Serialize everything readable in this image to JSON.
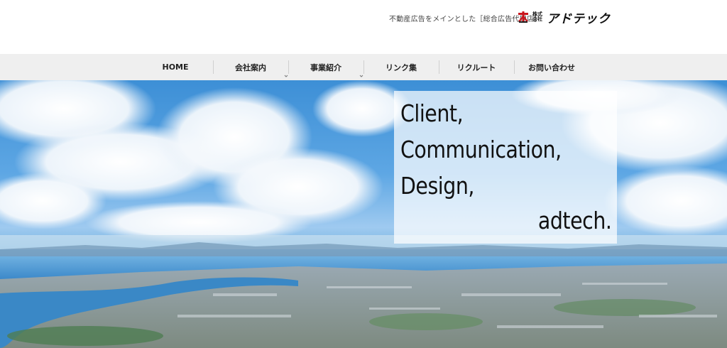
{
  "header": {
    "tagline": "不動産広告をメインとした［総合広告代理店］",
    "logo": {
      "small_top": "株式",
      "small_bottom": "会社",
      "name": "アドテック"
    }
  },
  "nav": {
    "items": [
      {
        "label": "HOME",
        "has_submenu": false
      },
      {
        "label": "会社案内",
        "has_submenu": true
      },
      {
        "label": "事業紹介",
        "has_submenu": true
      },
      {
        "label": "リンク集",
        "has_submenu": false
      },
      {
        "label": "リクルート",
        "has_submenu": false
      },
      {
        "label": "お問い合わせ",
        "has_submenu": false
      }
    ]
  },
  "hero": {
    "copy": [
      "Client,",
      "Communication,",
      "Design,",
      "adtech."
    ]
  },
  "colors": {
    "nav_bg": "#efefef",
    "logo_red": "#c8161d",
    "sky": "#4a98dc"
  },
  "icons": [
    "logo-mark-icon",
    "chevron-down-icon"
  ]
}
